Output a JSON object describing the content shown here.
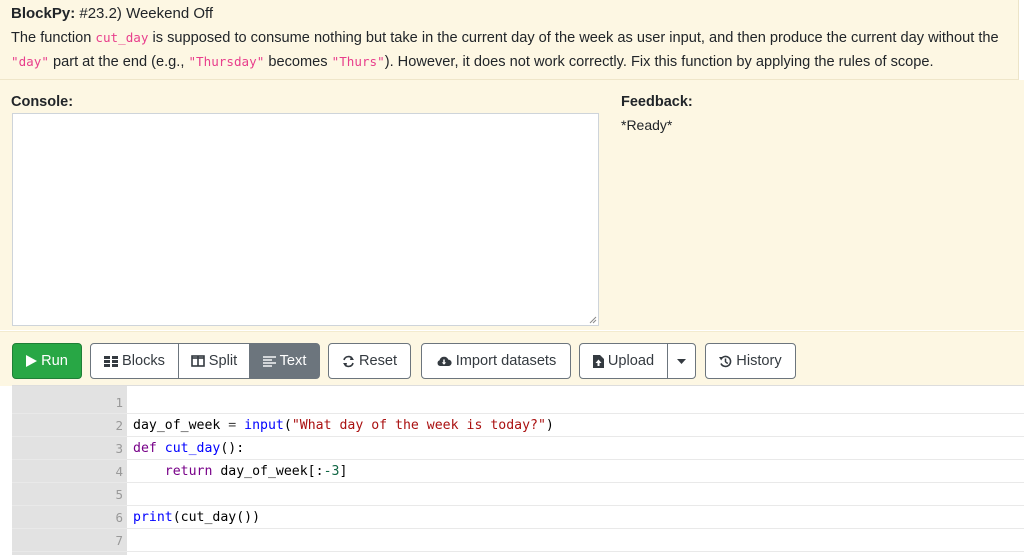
{
  "header": {
    "app_name": "BlockPy:",
    "assignment_title": "#23.2) Weekend Off",
    "instructions": {
      "p1": "The function ",
      "c1": "cut_day",
      "p2": " is supposed to consume nothing but take in the current day of the week as user input, and then produce the current day without the ",
      "c2": "\"day\"",
      "p3": " part at the end (e.g., ",
      "c3": "\"Thursday\"",
      "p4": " becomes ",
      "c4": "\"Thurs\"",
      "p5": "). However, it does not work correctly. Fix this function by applying the rules of scope."
    }
  },
  "console": {
    "label": "Console:",
    "content": ""
  },
  "feedback": {
    "label": "Feedback:",
    "text": "*Ready*"
  },
  "toolbar": {
    "run": "Run",
    "blocks": "Blocks",
    "split": "Split",
    "text": "Text",
    "reset": "Reset",
    "import": "Import datasets",
    "upload": "Upload",
    "history": "History"
  },
  "editor": {
    "line_numbers": [
      "1",
      "2",
      "3",
      "4",
      "5",
      "6",
      "7"
    ],
    "code": {
      "l2_var": "day_of_week",
      "l2_eq": " = ",
      "l2_fn": "input",
      "l2_open": "(",
      "l2_str": "\"What day of the week is today?\"",
      "l2_close": ")",
      "l3_kw": "def",
      "l3_sp": " ",
      "l3_fn": "cut_day",
      "l3_rest": "():",
      "l4_indent": "    ",
      "l4_kw": "return",
      "l4_a": " day_of_week[:",
      "l4_num": "-3",
      "l4_b": "]",
      "l6_fn": "print",
      "l6_rest": "(cut_day())"
    }
  },
  "colors": {
    "header_bg": "#fdf7e3",
    "run_green": "#28a745",
    "active_gray": "#6c757d",
    "code_inline": "#e83e8c",
    "keyword": "#770088",
    "builtin": "#0000ff",
    "string": "#aa1111",
    "number": "#116644"
  },
  "icons": [
    "play-icon",
    "blocks-icon",
    "split-icon",
    "text-lines-icon",
    "reset-icon",
    "cloud-download-icon",
    "file-upload-icon",
    "caret-down-icon",
    "history-icon",
    "resize-grip-icon"
  ]
}
